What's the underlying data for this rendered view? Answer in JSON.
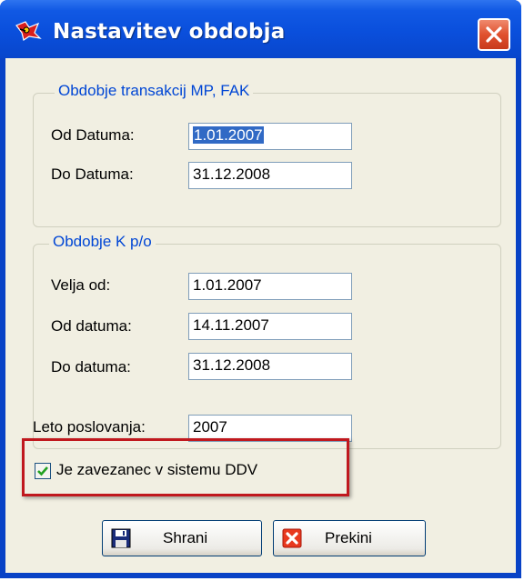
{
  "window": {
    "title": "Nastavitev obdobja"
  },
  "group_transactions": {
    "title": "Obdobje transakcij MP, FAK",
    "from_label": "Od Datuma:",
    "from_value": "1.01.2007",
    "to_label": "Do Datuma:",
    "to_value": "31.12.2008"
  },
  "group_kpo": {
    "title": "Obdobje K p/o",
    "valid_label": "Velja od:",
    "valid_value": "1.01.2007",
    "from_label": "Od datuma:",
    "from_value": "14.11.2007",
    "to_label": "Do datuma:",
    "to_value": "31.12.2008"
  },
  "business_year": {
    "label": "Leto poslovanja:",
    "value": "2007"
  },
  "vat_checkbox": {
    "label": "Je zavezanec v sistemu DDV",
    "checked": true
  },
  "buttons": {
    "save_label": "Shrani",
    "cancel_label": "Prekini"
  },
  "colors": {
    "title_bar": "#0a4fdc",
    "group_title": "#0046d5",
    "highlight_border": "#c0181e",
    "selection": "#316ac5",
    "dialog_bg": "#f1efe2"
  }
}
